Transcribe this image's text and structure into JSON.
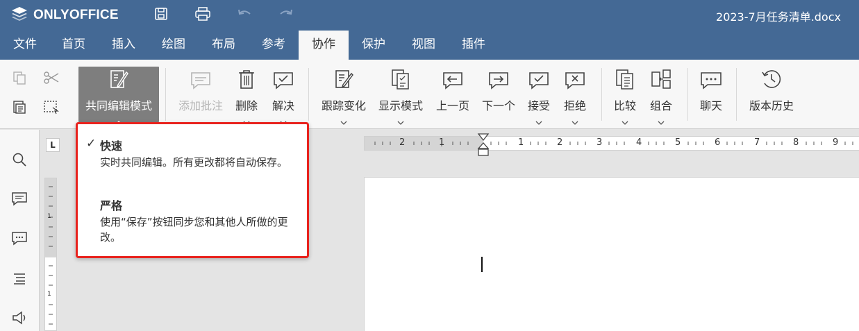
{
  "app": {
    "logo_text": "ONLYOFFICE",
    "doc_title": "2023-7月任务清单.docx"
  },
  "colors": {
    "header": "#446995",
    "accent_red": "#e8231e",
    "pressed": "#7e7e7e"
  },
  "quick_access": [
    {
      "icon": "save-icon"
    },
    {
      "icon": "print-icon"
    },
    {
      "icon": "undo-icon"
    },
    {
      "icon": "redo-icon"
    }
  ],
  "tabs": [
    {
      "label": "文件"
    },
    {
      "label": "首页"
    },
    {
      "label": "插入"
    },
    {
      "label": "绘图"
    },
    {
      "label": "布局"
    },
    {
      "label": "参考"
    },
    {
      "label": "协作"
    },
    {
      "label": "保护"
    },
    {
      "label": "视图"
    },
    {
      "label": "插件"
    }
  ],
  "active_tab": "协作",
  "toolbar": {
    "coedit": "共同编辑模式",
    "add_comment": "添加批注",
    "delete": "删除",
    "resolve": "解决",
    "track": "跟踪变化",
    "display": "显示模式",
    "prev": "上一页",
    "next": "下一个",
    "accept": "接受",
    "reject": "拒绝",
    "compare": "比较",
    "combine": "组合",
    "chat": "聊天",
    "history": "版本历史"
  },
  "ruler": {
    "labels": [
      "2",
      "1",
      "",
      "1",
      "2",
      "3",
      "4",
      "5",
      "6",
      "7",
      "8",
      "9"
    ]
  },
  "tab_stop": "L",
  "coedit_menu": {
    "options": [
      {
        "title": "快速",
        "desc": "实时共同编辑。所有更改都将自动保存。",
        "checked": true,
        "check": "✓"
      },
      {
        "title": "严格",
        "desc": "使用“保存”按钮同步您和其他人所做的更改。",
        "checked": false,
        "check": ""
      }
    ]
  }
}
